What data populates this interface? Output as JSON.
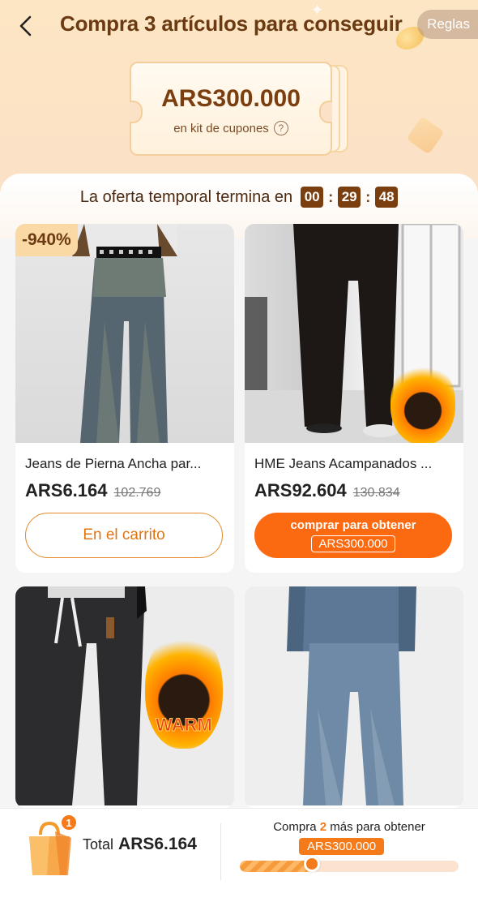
{
  "header": {
    "title": "Compra 3 artículos para conseguir",
    "rules_label": "Reglas"
  },
  "coupon": {
    "amount": "ARS300.000",
    "subtitle": "en kit de cupones"
  },
  "countdown": {
    "label": "La oferta temporal termina en",
    "hours": "00",
    "minutes": "29",
    "seconds": "48"
  },
  "products": [
    {
      "name": "Jeans de Pierna Ancha par...",
      "price": "ARS6.164",
      "old_price": "102.769",
      "badge": "-940%",
      "button": "En el carrito"
    },
    {
      "name": "HME Jeans Acampanados ...",
      "price": "ARS92.604",
      "old_price": "130.834",
      "button_line1": "comprar para obtener",
      "button_line2": "ARS300.000"
    },
    {
      "image_text": "WARM"
    },
    {}
  ],
  "bottom_bar": {
    "cart_count": "1",
    "total_label": "Total",
    "total_amount": "ARS6.164",
    "progress_prefix": "Compra",
    "progress_count": "2",
    "progress_suffix": "más para obtener",
    "goal": "ARS300.000",
    "progress_fraction": 0.33
  },
  "colors": {
    "accent": "#fb6a10",
    "brown": "#7a3e0f"
  }
}
